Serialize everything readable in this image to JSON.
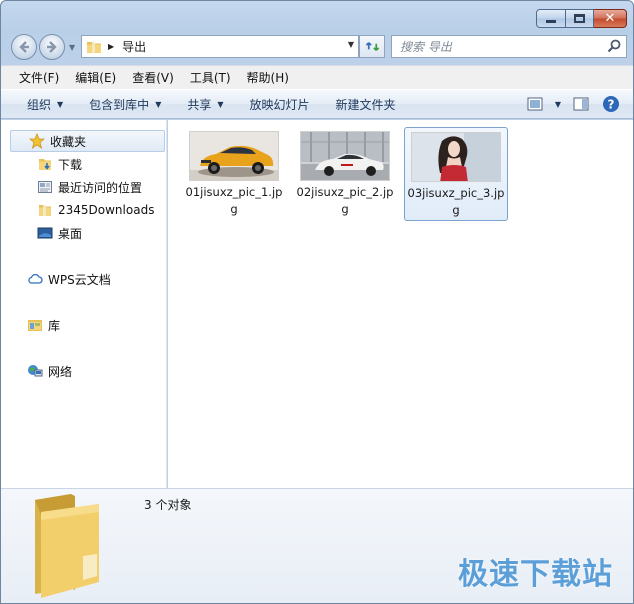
{
  "window": {
    "folder_name": "导出"
  },
  "search": {
    "placeholder": "搜索 导出"
  },
  "menubar": [
    "文件(F)",
    "编辑(E)",
    "查看(V)",
    "工具(T)",
    "帮助(H)"
  ],
  "toolbar": {
    "organize": "组织",
    "include_in_library": "包含到库中",
    "share": "共享",
    "slideshow": "放映幻灯片",
    "new_folder": "新建文件夹"
  },
  "nav": {
    "favorites": "收藏夹",
    "downloads": "下载",
    "recent_places": "最近访问的位置",
    "downloads_2345": "2345Downloads",
    "desktop": "桌面",
    "wps_cloud": "WPS云文档",
    "libraries": "库",
    "network": "网络"
  },
  "files": [
    {
      "name": "01jisuxz_pic_1.jpg",
      "thumb": "orange-suv"
    },
    {
      "name": "02jisuxz_pic_2.jpg",
      "thumb": "white-sports-car"
    },
    {
      "name": "03jisuxz_pic_3.jpg",
      "thumb": "woman-portrait"
    }
  ],
  "details": {
    "count": "3 个对象"
  },
  "watermark": "极速下载站",
  "colors": {
    "accent": "#1e395b",
    "watermark": "#5c9fd8",
    "selection": "#b8cde6"
  }
}
